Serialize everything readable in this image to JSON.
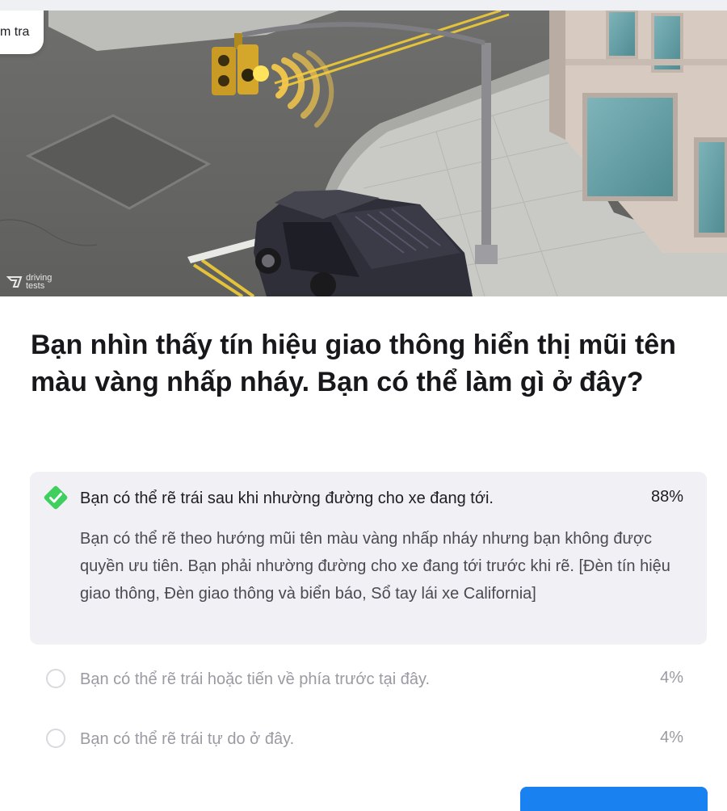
{
  "pill": {
    "label": "m tra"
  },
  "watermark": {
    "line1": "driving",
    "line2": "tests"
  },
  "question": {
    "text": "Bạn nhìn thấy tín hiệu giao thông hiển thị mũi tên màu vàng nhấp nháy. Bạn có thể làm gì ở đây?"
  },
  "answers": [
    {
      "text": "Bạn có thể rẽ trái sau khi nhường đường cho xe đang tới.",
      "percent": "88%",
      "correct": true,
      "explanation": "Bạn có thể rẽ theo hướng mũi tên màu vàng nhấp nháy nhưng bạn không được quyền ưu tiên. Bạn phải nhường đường cho xe đang tới trước khi rẽ. [Đèn tín hiệu giao thông, Đèn giao thông và biển báo, Sổ tay lái xe California]"
    },
    {
      "text": "Bạn có thể rẽ trái hoặc tiến về phía trước tại đây.",
      "percent": "4%",
      "correct": false
    },
    {
      "text": "Bạn có thể rẽ trái tự do ở đây.",
      "percent": "4%",
      "correct": false
    }
  ],
  "colors": {
    "correct": "#3fcf5f",
    "primary": "#1982f0",
    "card": "#f0f0f5",
    "muted": "#9a9aa2"
  },
  "icons": {
    "correct_marker": "check-diamond-icon",
    "option_marker": "radio-circle-icon"
  }
}
